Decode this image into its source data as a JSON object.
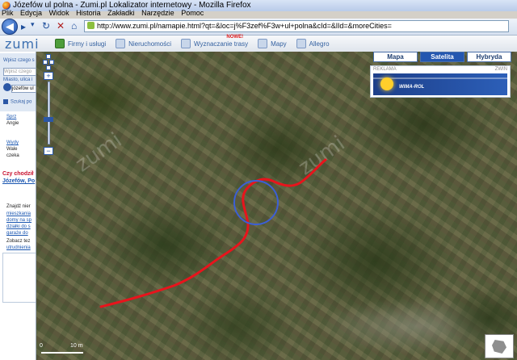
{
  "window": {
    "title": "Józefów ul polna - Zumi.pl Lokalizator internetowy - Mozilla Firefox"
  },
  "menu": [
    "Plik",
    "Edycja",
    "Widok",
    "Historia",
    "Zakładki",
    "Narzędzie",
    "Pomoc"
  ],
  "browser": {
    "url": "http://www.zumi.pl/namapie.html?qt=&loc=j%F3zef%F3w+ul+polna&cId=&lId=&moreCities="
  },
  "site": {
    "logo": "zumi",
    "tabs": [
      {
        "label": "Firmy i usługi",
        "badge": ""
      },
      {
        "label": "Nieruchomości",
        "badge": ""
      },
      {
        "label": "Wyznaczanie trasy",
        "badge": "NOWE!"
      },
      {
        "label": "Mapy",
        "badge": ""
      },
      {
        "label": "Allegro",
        "badge": ""
      }
    ]
  },
  "sidebar": {
    "search_label": "Wpisz czego s",
    "search_placeholder": "Wpisz czego sz",
    "location_label": "Miasto, ulica i",
    "location_value": "józefów ul",
    "search_button": "Szukaj po",
    "links": [
      "Sprz",
      "Wydy",
      "Józefów, Po",
      "mieszkania",
      "domy na sp",
      "działki do s",
      "garaże do",
      "utrudnienia"
    ],
    "texts": [
      "Angie",
      "Wale",
      "czeka",
      "Znajdź nier",
      "Zobacz tez"
    ],
    "question": "Czy chodził"
  },
  "maptypes": [
    {
      "label": "Mapa",
      "active": false
    },
    {
      "label": "Satelita",
      "active": true
    },
    {
      "label": "Hybryda",
      "active": false
    }
  ],
  "ad": {
    "label": "REKLAMA",
    "close": "ZWIŃ",
    "brand": "WIMA-ROL"
  },
  "map": {
    "watermark": "zumi",
    "scale": {
      "start": "0",
      "end": "10 m"
    },
    "route_color": "#e8141c",
    "marker_color": "#3c5fd6"
  }
}
